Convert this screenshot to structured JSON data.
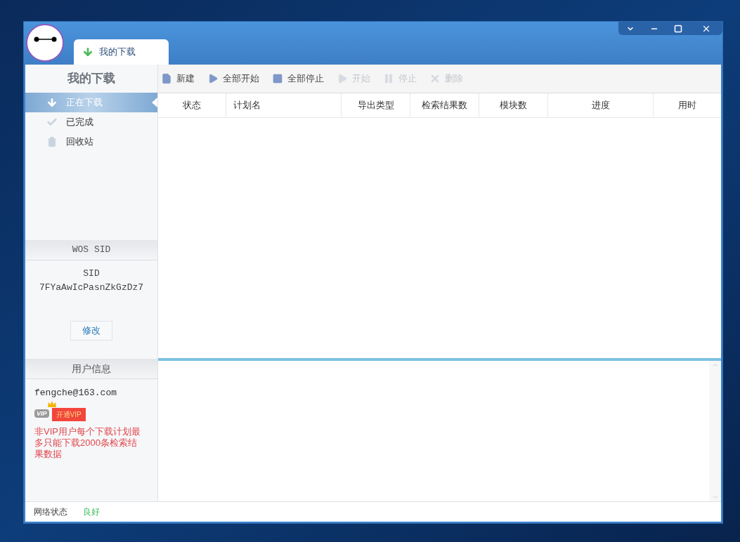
{
  "window": {
    "tabs": [
      {
        "label": "我的下载",
        "selected": true
      }
    ]
  },
  "sidebar": {
    "title": "我的下载",
    "items": [
      {
        "label": "正在下载",
        "kind": "download",
        "selected": true
      },
      {
        "label": "已完成",
        "kind": "check",
        "selected": false
      },
      {
        "label": "回收站",
        "kind": "trash",
        "selected": false
      }
    ],
    "sid_panel": {
      "header": "WOS SID",
      "label": "SID",
      "value": "7FYaAwIcPasnZkGzDz7",
      "button": "修改"
    },
    "user_panel": {
      "header": "用户信息",
      "email": "fengche@163.com",
      "vip_badge": "VIP",
      "upgrade_button": "开通VIP",
      "notice": "非VIP用户每个下载计划最多只能下载2000条检索结果数据"
    }
  },
  "toolbar": [
    {
      "label": "新建",
      "kind": "file",
      "disabled": false
    },
    {
      "label": "全部开始",
      "kind": "play",
      "disabled": false
    },
    {
      "label": "全部停止",
      "kind": "stop",
      "disabled": false
    },
    {
      "label": "开始",
      "kind": "play",
      "disabled": true
    },
    {
      "label": "停止",
      "kind": "pause",
      "disabled": true
    },
    {
      "label": "删除",
      "kind": "delete",
      "disabled": true
    }
  ],
  "table": {
    "columns": [
      "状态",
      "计划名",
      "导出类型",
      "检索结果数",
      "模块数",
      "进度",
      "用时"
    ]
  },
  "status_bar": {
    "label": "网络状态",
    "value": "良好"
  }
}
